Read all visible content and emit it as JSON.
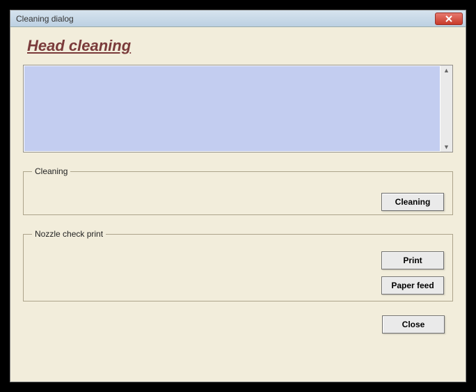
{
  "window": {
    "title": "Cleaning dialog"
  },
  "heading": "Head cleaning",
  "log": {
    "value": ""
  },
  "groups": {
    "cleaning": {
      "legend": "Cleaning",
      "button": "Cleaning"
    },
    "nozzle": {
      "legend": "Nozzle check print",
      "print": "Print",
      "paperfeed": "Paper feed"
    }
  },
  "close_button": "Close"
}
